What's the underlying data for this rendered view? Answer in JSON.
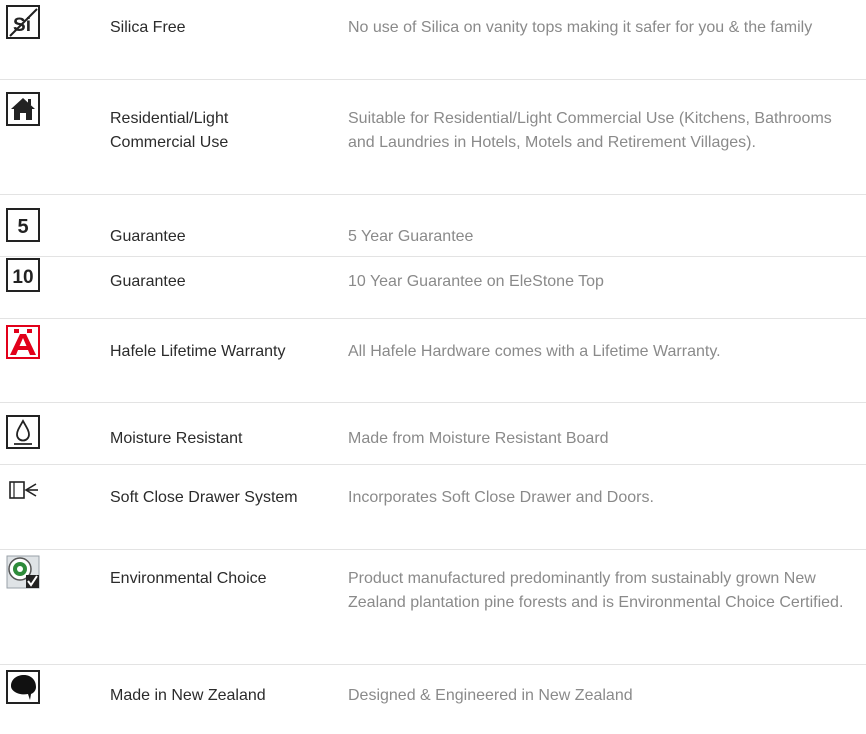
{
  "features": [
    {
      "icon": "silica-free-icon",
      "icon_text": "Si",
      "name": "Silica Free",
      "desc": "No use of Silica on vanity tops making it safer for you & the family"
    },
    {
      "icon": "house-icon",
      "name": "Residential/Light Commercial Use",
      "desc": "Suitable for Residential/Light Commercial Use (Kitchens, Bathrooms and Laundries in Hotels, Motels and Retirement Villages)."
    },
    {
      "icon": "five-year-icon",
      "icon_text": "5",
      "name": "Guarantee",
      "desc": "5 Year Guarantee"
    },
    {
      "icon": "ten-year-icon",
      "icon_text": "10",
      "name": "Guarantee",
      "desc": "10 Year Guarantee on EleStone Top"
    },
    {
      "icon": "hafele-logo-icon",
      "name": "Hafele Lifetime Warranty",
      "desc": "All Hafele Hardware comes with a Lifetime Warranty."
    },
    {
      "icon": "water-drop-icon",
      "name": "Moisture Resistant",
      "desc": "Made from Moisture Resistant Board"
    },
    {
      "icon": "soft-close-drawer-icon",
      "name": "Soft Close Drawer System",
      "desc": "Incorporates Soft Close Drawer and Doors."
    },
    {
      "icon": "environmental-choice-icon",
      "name": "Environmental Choice",
      "desc": "Product manufactured predominantly from sustainably grown New Zealand plantation pine forests and is Environmental Choice Certified."
    },
    {
      "icon": "kiwi-icon",
      "name": "Made in New Zealand",
      "desc": "Designed & Engineered in New Zealand"
    }
  ],
  "colors": {
    "name_text": "#2b2b2b",
    "desc_text": "#8a8a8a",
    "divider": "#e3e3e3",
    "hafele_red": "#e2001a"
  }
}
